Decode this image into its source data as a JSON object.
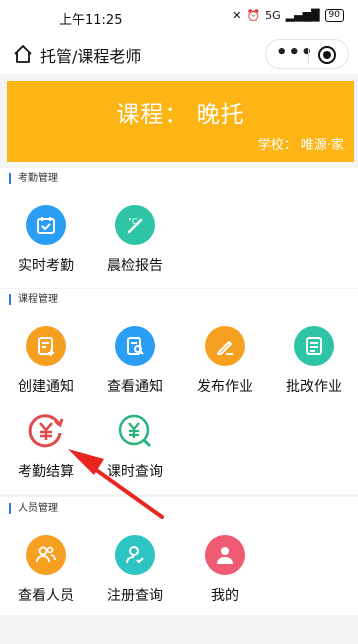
{
  "status": {
    "time": "上午11:25",
    "network": "5G",
    "battery": "90"
  },
  "navbar": {
    "title": "托管/课程老师",
    "more_label": "•••"
  },
  "banner": {
    "course": "课程： 晚托",
    "school": "学校： 唯源·家"
  },
  "sections": {
    "attendance": {
      "title": "考勤管理",
      "items": [
        {
          "label": "实时考勤",
          "icon": "calendar-check-icon",
          "color": "#2a9df4"
        },
        {
          "label": "晨检报告",
          "icon": "thermometer-icon",
          "color": "#2ec4a6"
        }
      ]
    },
    "course": {
      "title": "课程管理",
      "items": [
        {
          "label": "创建通知",
          "icon": "create-note-icon",
          "color": "#f5a021"
        },
        {
          "label": "查看通知",
          "icon": "view-note-icon",
          "color": "#2a9df4"
        },
        {
          "label": "发布作业",
          "icon": "pencil-icon",
          "color": "#f5a021"
        },
        {
          "label": "批改作业",
          "icon": "checklist-icon",
          "color": "#2ec4a6"
        },
        {
          "label": "考勤结算",
          "icon": "yen-refresh-icon",
          "color": "#e04b4b"
        },
        {
          "label": "课时查询",
          "icon": "yen-search-icon",
          "color": "#2ab27b"
        }
      ]
    },
    "people": {
      "title": "人员管理",
      "items": [
        {
          "label": "查看人员",
          "icon": "people-icon",
          "color": "#f5a021"
        },
        {
          "label": "注册查询",
          "icon": "user-check-icon",
          "color": "#2ec4c4"
        },
        {
          "label": "我的",
          "icon": "my-profile-icon",
          "color": "#ef5b73"
        }
      ]
    }
  },
  "annotation": {
    "color": "#e8251f"
  }
}
